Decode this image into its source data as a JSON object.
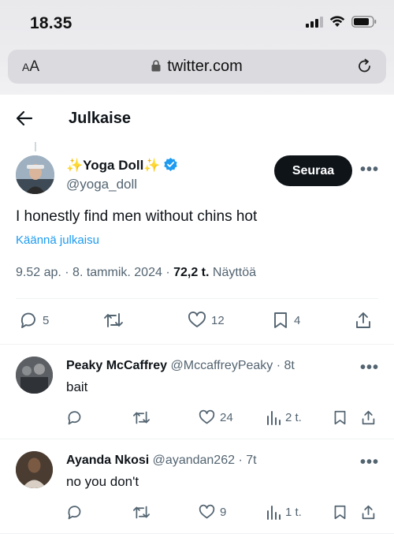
{
  "status_bar": {
    "time": "18.35"
  },
  "browser": {
    "aa_label": "AA",
    "url": "twitter.com"
  },
  "header": {
    "title": "Julkaise"
  },
  "tweet": {
    "display_name": "✨Yoga Doll✨",
    "handle": "@yoga_doll",
    "follow_label": "Seuraa",
    "more": "•••",
    "text": "I honestly find men without chins hot",
    "translate_label": "Käännä julkaisu",
    "time": "9.52 ap.",
    "date": "8. tammik. 2024",
    "views_count": "72,2 t.",
    "views_label": "Näyttöä",
    "stats": {
      "replies": "5",
      "retweets": "",
      "likes": "12",
      "bookmarks": "4"
    }
  },
  "replies": [
    {
      "display_name": "Peaky McCaffrey",
      "handle": "@MccaffreyPeaky",
      "age": "· 8t",
      "text": "bait",
      "more": "•••",
      "likes": "24",
      "views": "2 t."
    },
    {
      "display_name": "Ayanda Nkosi",
      "handle": "@ayandan262",
      "age": "· 7t",
      "text": "no you don't",
      "more": "•••",
      "likes": "9",
      "views": "1 t."
    }
  ],
  "colors": {
    "accent": "#1d9bf0",
    "text": "#0f1419",
    "muted": "#536471",
    "divider": "#eff3f4"
  }
}
